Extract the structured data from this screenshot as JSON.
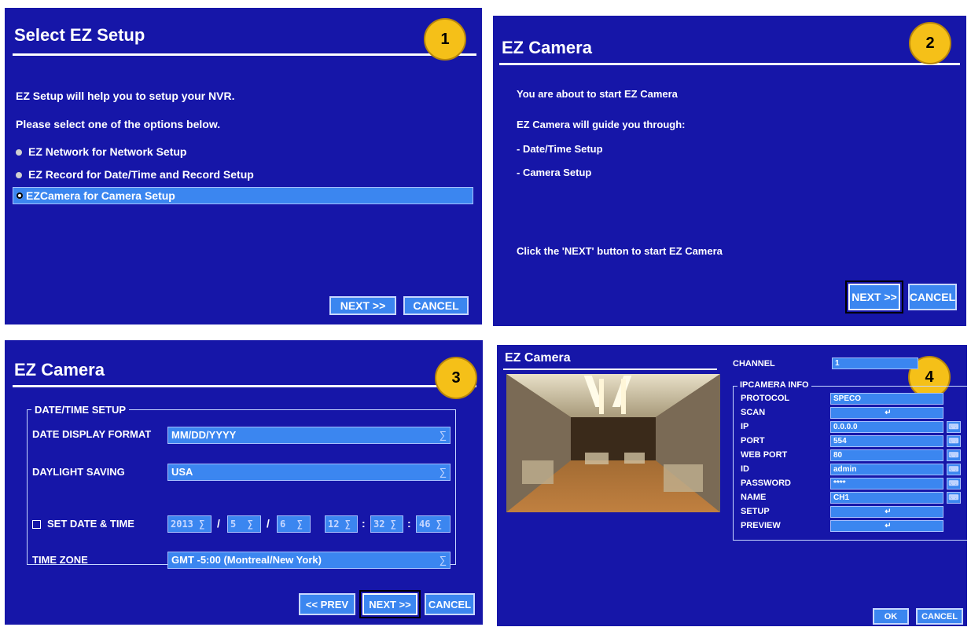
{
  "panel1": {
    "title": "Select EZ Setup",
    "badge": "1",
    "line1": "EZ Setup will help you to setup your NVR.",
    "line2": "Please select one of the options below.",
    "options": [
      "EZ Network for Network Setup",
      "EZ Record for Date/Time and Record Setup",
      "EZCamera for Camera Setup"
    ],
    "next": "NEXT >>",
    "cancel": "CANCEL"
  },
  "panel2": {
    "title": "EZ Camera",
    "badge": "2",
    "line1": "You are about to start EZ Camera",
    "line2": "EZ Camera will guide you through:",
    "line3": "- Date/Time Setup",
    "line4": "- Camera Setup",
    "line5": "Click the 'NEXT' button to start EZ Camera",
    "next": "NEXT >>",
    "cancel": "CANCEL"
  },
  "panel3": {
    "title": "EZ Camera",
    "badge": "3",
    "group": "DATE/TIME SETUP",
    "date_format_label": "DATE DISPLAY FORMAT",
    "date_format_value": "MM/DD/YYYY",
    "dst_label": "DAYLIGHT SAVING",
    "dst_value": "USA",
    "set_label": "SET DATE & TIME",
    "year": "2013",
    "month": "5",
    "day": "6",
    "hour": "12",
    "minute": "32",
    "second": "46",
    "tz_label": "TIME ZONE",
    "tz_value": "GMT -5:00 (Montreal/New York)",
    "prev": "<< PREV",
    "next": "NEXT >>",
    "cancel": "CANCEL"
  },
  "panel4": {
    "title": "EZ Camera",
    "badge": "4",
    "channel_label": "CHANNEL",
    "channel_value": "1",
    "group": "IPCAMERA INFO",
    "protocol_label": "PROTOCOL",
    "protocol_value": "SPECO",
    "scan_label": "SCAN",
    "ip_label": "IP",
    "ip_value": "0.0.0.0",
    "port_label": "PORT",
    "port_value": "554",
    "webport_label": "WEB PORT",
    "webport_value": "80",
    "id_label": "ID",
    "id_value": "admin",
    "password_label": "PASSWORD",
    "password_value": "****",
    "name_label": "NAME",
    "name_value": "CH1",
    "setup_label": "SETUP",
    "preview_label": "PREVIEW",
    "ok": "OK",
    "cancel": "CANCEL"
  },
  "colors": {
    "panel_bg": "#1616a8",
    "field": "#3b86f0",
    "badge": "#f5c018"
  }
}
